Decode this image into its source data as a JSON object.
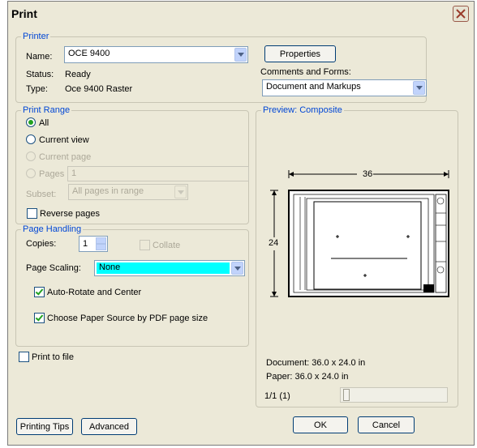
{
  "title": "Print",
  "printer": {
    "legend": "Printer",
    "name_label": "Name:",
    "name_value": "OCE 9400",
    "status_label": "Status:",
    "status_value": "Ready",
    "type_label": "Type:",
    "type_value": "Oce 9400 Raster",
    "properties_button": "Properties",
    "comments_label": "Comments and Forms:",
    "comments_value": "Document and Markups"
  },
  "print_range": {
    "legend": "Print Range",
    "all": "All",
    "current_view": "Current view",
    "current_page": "Current page",
    "pages": "Pages",
    "pages_value": "1",
    "subset_label": "Subset:",
    "subset_value": "All pages in range",
    "reverse_pages": "Reverse pages"
  },
  "page_handling": {
    "legend": "Page Handling",
    "copies_label": "Copies:",
    "copies_value": "1",
    "collate": "Collate",
    "scaling_label": "Page Scaling:",
    "scaling_value": "None",
    "auto_rotate": "Auto-Rotate and Center",
    "paper_source": "Choose Paper Source by PDF page size"
  },
  "preview": {
    "legend": "Preview: Composite",
    "width_dim": "36",
    "height_dim": "24",
    "document_size": "Document: 36.0 x 24.0 in",
    "paper_size": "Paper: 36.0 x 24.0 in",
    "page_counter": "1/1 (1)"
  },
  "print_to_file": "Print to file",
  "buttons": {
    "printing_tips": "Printing Tips",
    "advanced": "Advanced",
    "ok": "OK",
    "cancel": "Cancel"
  },
  "colors": {
    "group_legend": "#0046d5",
    "scaling_highlight": "#00ffff",
    "dialog_bg": "#ece9d8"
  }
}
